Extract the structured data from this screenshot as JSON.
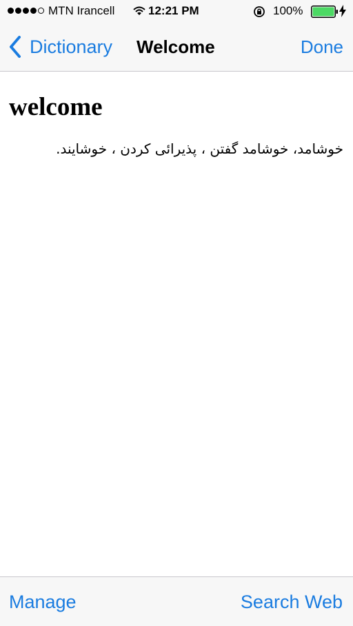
{
  "status_bar": {
    "carrier": "MTN Irancell",
    "time": "12:21 PM",
    "battery_percent": "100%",
    "signal_bars": 4,
    "signal_total": 5,
    "icons": [
      "signal-dots-icon",
      "wifi-icon",
      "rotation-lock-icon",
      "battery-icon",
      "charging-bolt-icon"
    ],
    "battery_color": "#4cd964"
  },
  "nav": {
    "back_label": "Dictionary",
    "title": "Welcome",
    "done_label": "Done"
  },
  "entry": {
    "word": "welcome",
    "definition": "خوشامد، خوشامد گفتن ، پذیرائی کردن ، خوشایند."
  },
  "toolbar": {
    "manage_label": "Manage",
    "search_web_label": "Search Web"
  },
  "colors": {
    "accent": "#1a7ce0",
    "bar_background": "#f7f7f7",
    "separator": "#c8c7cc"
  }
}
